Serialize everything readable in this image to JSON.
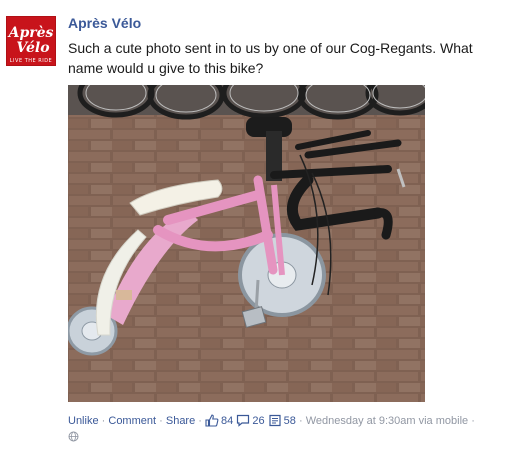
{
  "post": {
    "page_name": "Après Vélo",
    "avatar": {
      "logo_text_top": "Après",
      "logo_text_bottom": "Vélo",
      "logo_tagline": "LIVE THE RIDE",
      "brand_color": "#c8141b"
    },
    "text": "Such a cute photo sent in to us by one of our Cog-Regants. What name would u give to this bike?",
    "photo": {
      "subject": "pink child's bicycle with training wheels and road-bike drop handlebars on brick pavement"
    },
    "actions": {
      "unlike": "Unlike",
      "comment": "Comment",
      "share": "Share",
      "separator": "·",
      "likes_count": "84",
      "comments_count": "26",
      "shares_count": "58",
      "timestamp": "Wednesday at 9:30am via mobile",
      "icons": [
        "thumbs-up-icon",
        "comment-icon",
        "share-icon",
        "globe-icon"
      ]
    },
    "colors": {
      "link": "#3b5998",
      "meta": "#9197a3",
      "text": "#1a1a1a"
    }
  }
}
